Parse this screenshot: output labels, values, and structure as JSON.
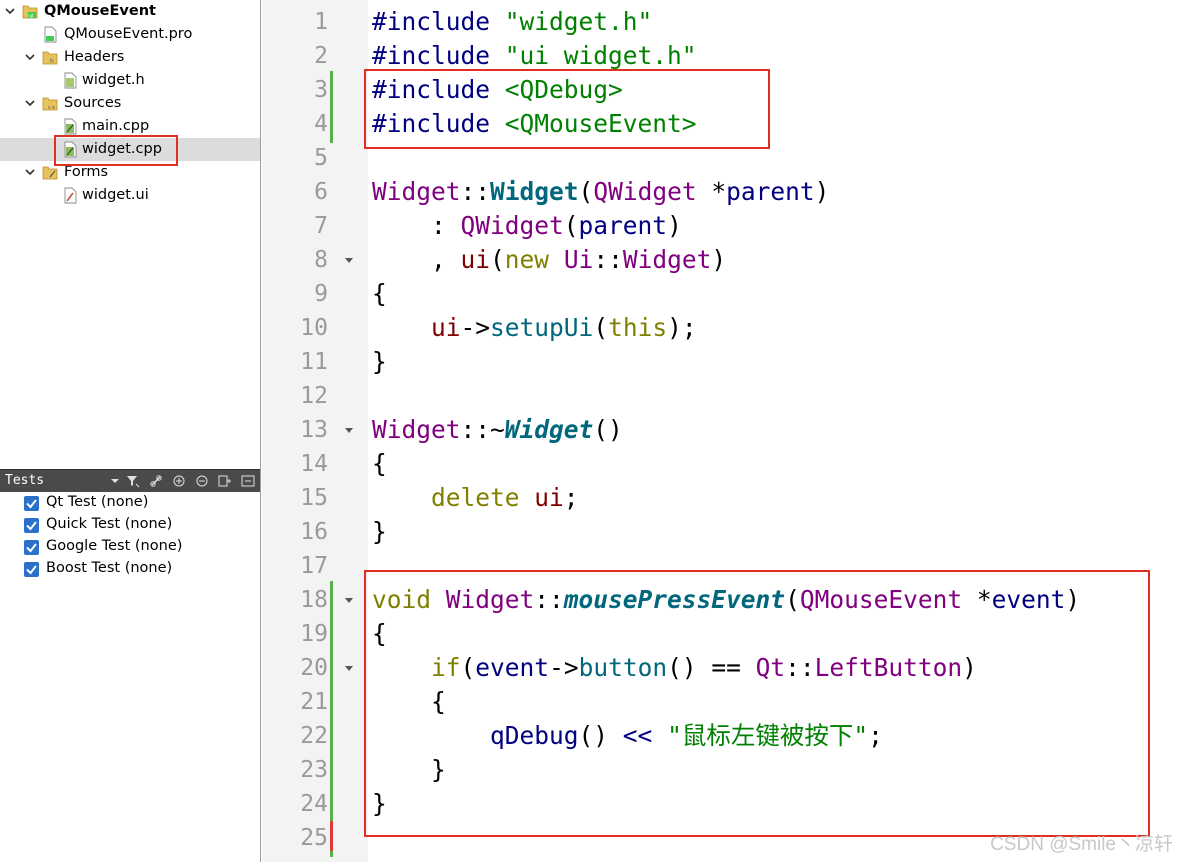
{
  "project_tree": {
    "project_name": "QMouseEvent",
    "pro_file": "QMouseEvent.pro",
    "headers_label": "Headers",
    "header_file": "widget.h",
    "sources_label": "Sources",
    "source_files": [
      "main.cpp",
      "widget.cpp"
    ],
    "forms_label": "Forms",
    "form_file": "widget.ui",
    "selected": "widget.cpp"
  },
  "tests_panel": {
    "title": "Tests",
    "items": [
      {
        "label": "Qt Test (none)",
        "checked": true
      },
      {
        "label": "Quick Test (none)",
        "checked": true
      },
      {
        "label": "Google Test (none)",
        "checked": true
      },
      {
        "label": "Boost Test (none)",
        "checked": true
      }
    ]
  },
  "editor": {
    "line_numbers": [
      "1",
      "2",
      "3",
      "4",
      "5",
      "6",
      "7",
      "8",
      "9",
      "10",
      "11",
      "12",
      "13",
      "14",
      "15",
      "16",
      "17",
      "18",
      "19",
      "20",
      "21",
      "22",
      "23",
      "24",
      "25"
    ],
    "lines": [
      [
        [
          "pp",
          "#include "
        ],
        [
          "str",
          "\"widget.h\""
        ]
      ],
      [
        [
          "pp",
          "#include "
        ],
        [
          "str",
          "\"ui_widget.h\""
        ]
      ],
      [
        [
          "pp",
          "#include "
        ],
        [
          "str",
          "<QDebug>"
        ]
      ],
      [
        [
          "pp",
          "#include "
        ],
        [
          "str",
          "<QMouseEvent>"
        ]
      ],
      [],
      [
        [
          "cls",
          "Widget"
        ],
        [
          "dflt",
          "::"
        ],
        [
          "fn",
          "Widget"
        ],
        [
          "dflt",
          "("
        ],
        [
          "cls",
          "QWidget"
        ],
        [
          "dflt",
          " *"
        ],
        [
          "op",
          "parent"
        ],
        [
          "dflt",
          ")"
        ]
      ],
      [
        [
          "dflt",
          "    : "
        ],
        [
          "cls",
          "QWidget"
        ],
        [
          "dflt",
          "("
        ],
        [
          "op",
          "parent"
        ],
        [
          "dflt",
          ")"
        ]
      ],
      [
        [
          "dflt",
          "    , "
        ],
        [
          "mem",
          "ui"
        ],
        [
          "dflt",
          "("
        ],
        [
          "kw",
          "new "
        ],
        [
          "cls",
          "Ui"
        ],
        [
          "dflt",
          "::"
        ],
        [
          "cls",
          "Widget"
        ],
        [
          "dflt",
          ")"
        ]
      ],
      [
        [
          "dflt",
          "{"
        ]
      ],
      [
        [
          "dflt",
          "    "
        ],
        [
          "mem",
          "ui"
        ],
        [
          "dflt",
          "->"
        ],
        [
          "call",
          "setupUi"
        ],
        [
          "dflt",
          "("
        ],
        [
          "kw",
          "this"
        ],
        [
          "dflt",
          ");"
        ]
      ],
      [
        [
          "dflt",
          "}"
        ]
      ],
      [],
      [
        [
          "cls",
          "Widget"
        ],
        [
          "dflt",
          "::~"
        ],
        [
          "fni",
          "Widget"
        ],
        [
          "dflt",
          "()"
        ]
      ],
      [
        [
          "dflt",
          "{"
        ]
      ],
      [
        [
          "dflt",
          "    "
        ],
        [
          "kw",
          "delete "
        ],
        [
          "mem",
          "ui"
        ],
        [
          "dflt",
          ";"
        ]
      ],
      [
        [
          "dflt",
          "}"
        ]
      ],
      [],
      [
        [
          "kw",
          "void "
        ],
        [
          "cls",
          "Widget"
        ],
        [
          "dflt",
          "::"
        ],
        [
          "fni",
          "mousePressEvent"
        ],
        [
          "dflt",
          "("
        ],
        [
          "cls",
          "QMouseEvent"
        ],
        [
          "dflt",
          " *"
        ],
        [
          "op",
          "event"
        ],
        [
          "dflt",
          ")"
        ]
      ],
      [
        [
          "dflt",
          "{"
        ]
      ],
      [
        [
          "dflt",
          "    "
        ],
        [
          "kw",
          "if"
        ],
        [
          "dflt",
          "("
        ],
        [
          "op",
          "event"
        ],
        [
          "dflt",
          "->"
        ],
        [
          "call",
          "button"
        ],
        [
          "dflt",
          "() == "
        ],
        [
          "cls",
          "Qt"
        ],
        [
          "dflt",
          "::"
        ],
        [
          "cls",
          "LeftButton"
        ],
        [
          "dflt",
          ")"
        ]
      ],
      [
        [
          "dflt",
          "    {"
        ]
      ],
      [
        [
          "dflt",
          "        "
        ],
        [
          "op",
          "qDebug"
        ],
        [
          "dflt",
          "() "
        ],
        [
          "op",
          "<<"
        ],
        [
          "dflt",
          " "
        ],
        [
          "str",
          "\"鼠标左键被按下\""
        ],
        [
          "dflt",
          ";"
        ]
      ],
      [
        [
          "dflt",
          "    }"
        ]
      ],
      [
        [
          "dflt",
          "}"
        ]
      ],
      []
    ],
    "fold_lines": [
      8,
      13,
      18,
      20
    ]
  },
  "watermark": "CSDN @Smile丶凉轩",
  "colors": {
    "annotation_box": "#e02f1f",
    "change_bar": "#5aaf4a",
    "change_bar_removed": "#e03a3a",
    "checkbox": "#2a71c9"
  }
}
